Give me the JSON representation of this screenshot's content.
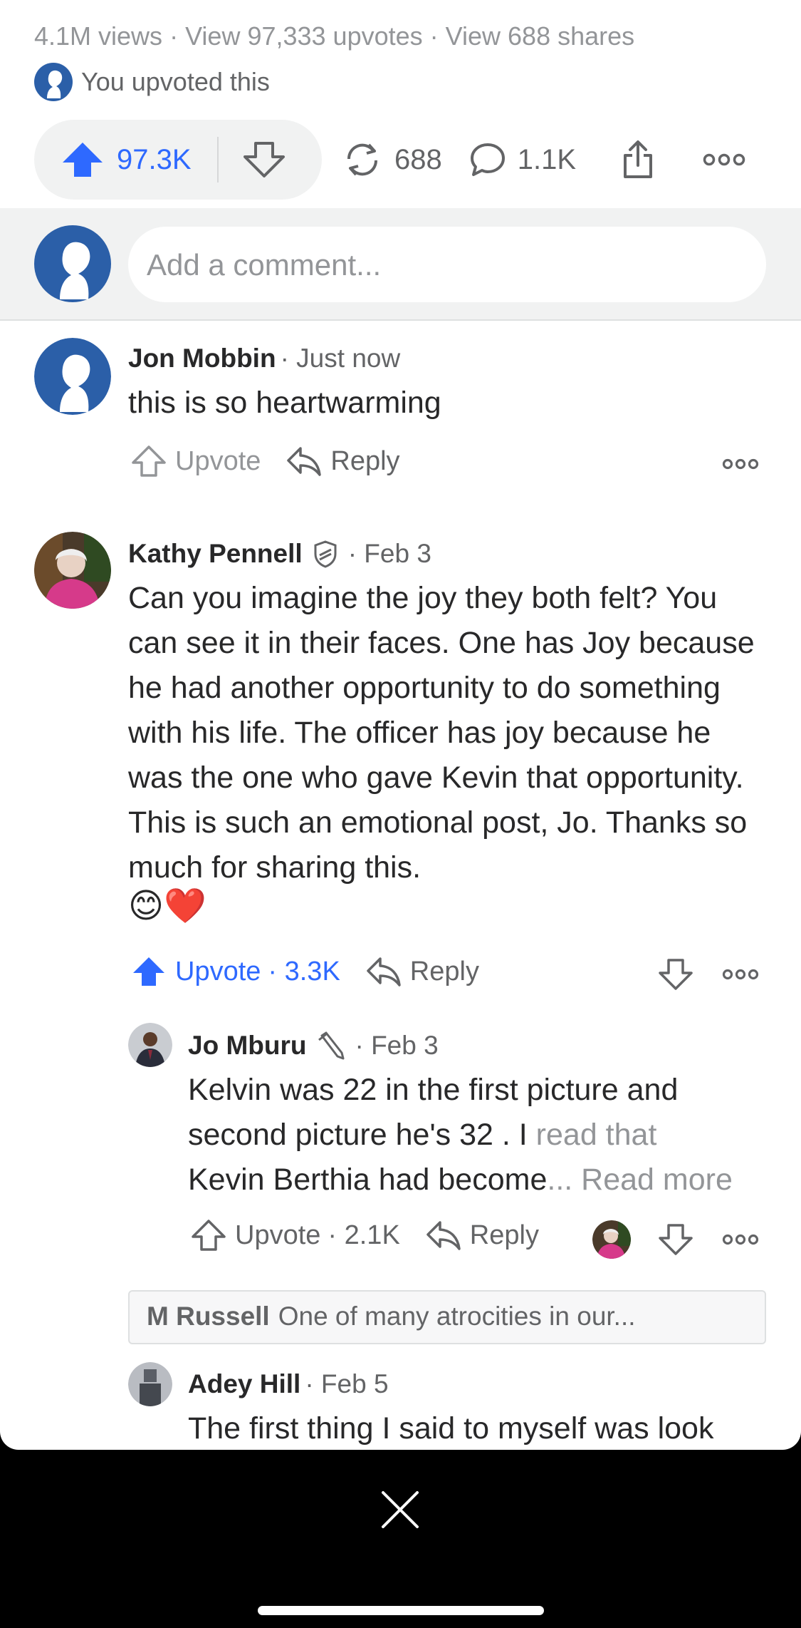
{
  "stats": {
    "views": "4.1M views",
    "upvotes": "View 97,333 upvotes",
    "shares": "View 688 shares",
    "separator": "·"
  },
  "you_upvoted": "You upvoted this",
  "actionbar": {
    "upvote_count": "97.3K",
    "share_count": "688",
    "comment_count": "1.1K"
  },
  "comment_input": {
    "placeholder": "Add a comment..."
  },
  "comments": [
    {
      "author": "Jon Mobbin",
      "meta": "· Just now",
      "body": "this is so heartwarming",
      "upvote_label": "Upvote",
      "reply_label": "Reply"
    },
    {
      "author": "Kathy Pennell",
      "meta": "· Feb 3",
      "body": "Can you imagine the joy they both felt? You can see it in their faces. One has Joy because he had another opportunity to do something with his life. The officer has joy because he was the one who gave Kevin that opportunity. This is such an emotional post, Jo. Thanks so much for sharing this.",
      "emoji": "😊❤️",
      "upvote_label": "Upvote",
      "upvote_count": "· 3.3K",
      "reply_label": "Reply"
    },
    {
      "author": "Jo Mburu",
      "meta": "· Feb 3",
      "body_1": "Kelvin was 22 in the first picture and",
      "body_2": "second picture he's 32 . I",
      "body_2_fade": "read that",
      "body_3": "Kevin Berthia had become",
      "body_3_fade": "...",
      "read_more": "Read more",
      "upvote_label": "Upvote",
      "upvote_count": "· 2.1K",
      "reply_label": "Reply"
    },
    {
      "author": "Adey Hill",
      "meta": "· Feb 5",
      "body": "The first thing I said to myself was look"
    }
  ],
  "quote": {
    "author": "M Russell",
    "text": "One of many atrocities in our..."
  },
  "colors": {
    "accent": "#2e69ff",
    "avatar_blue": "#2b5fa8"
  }
}
